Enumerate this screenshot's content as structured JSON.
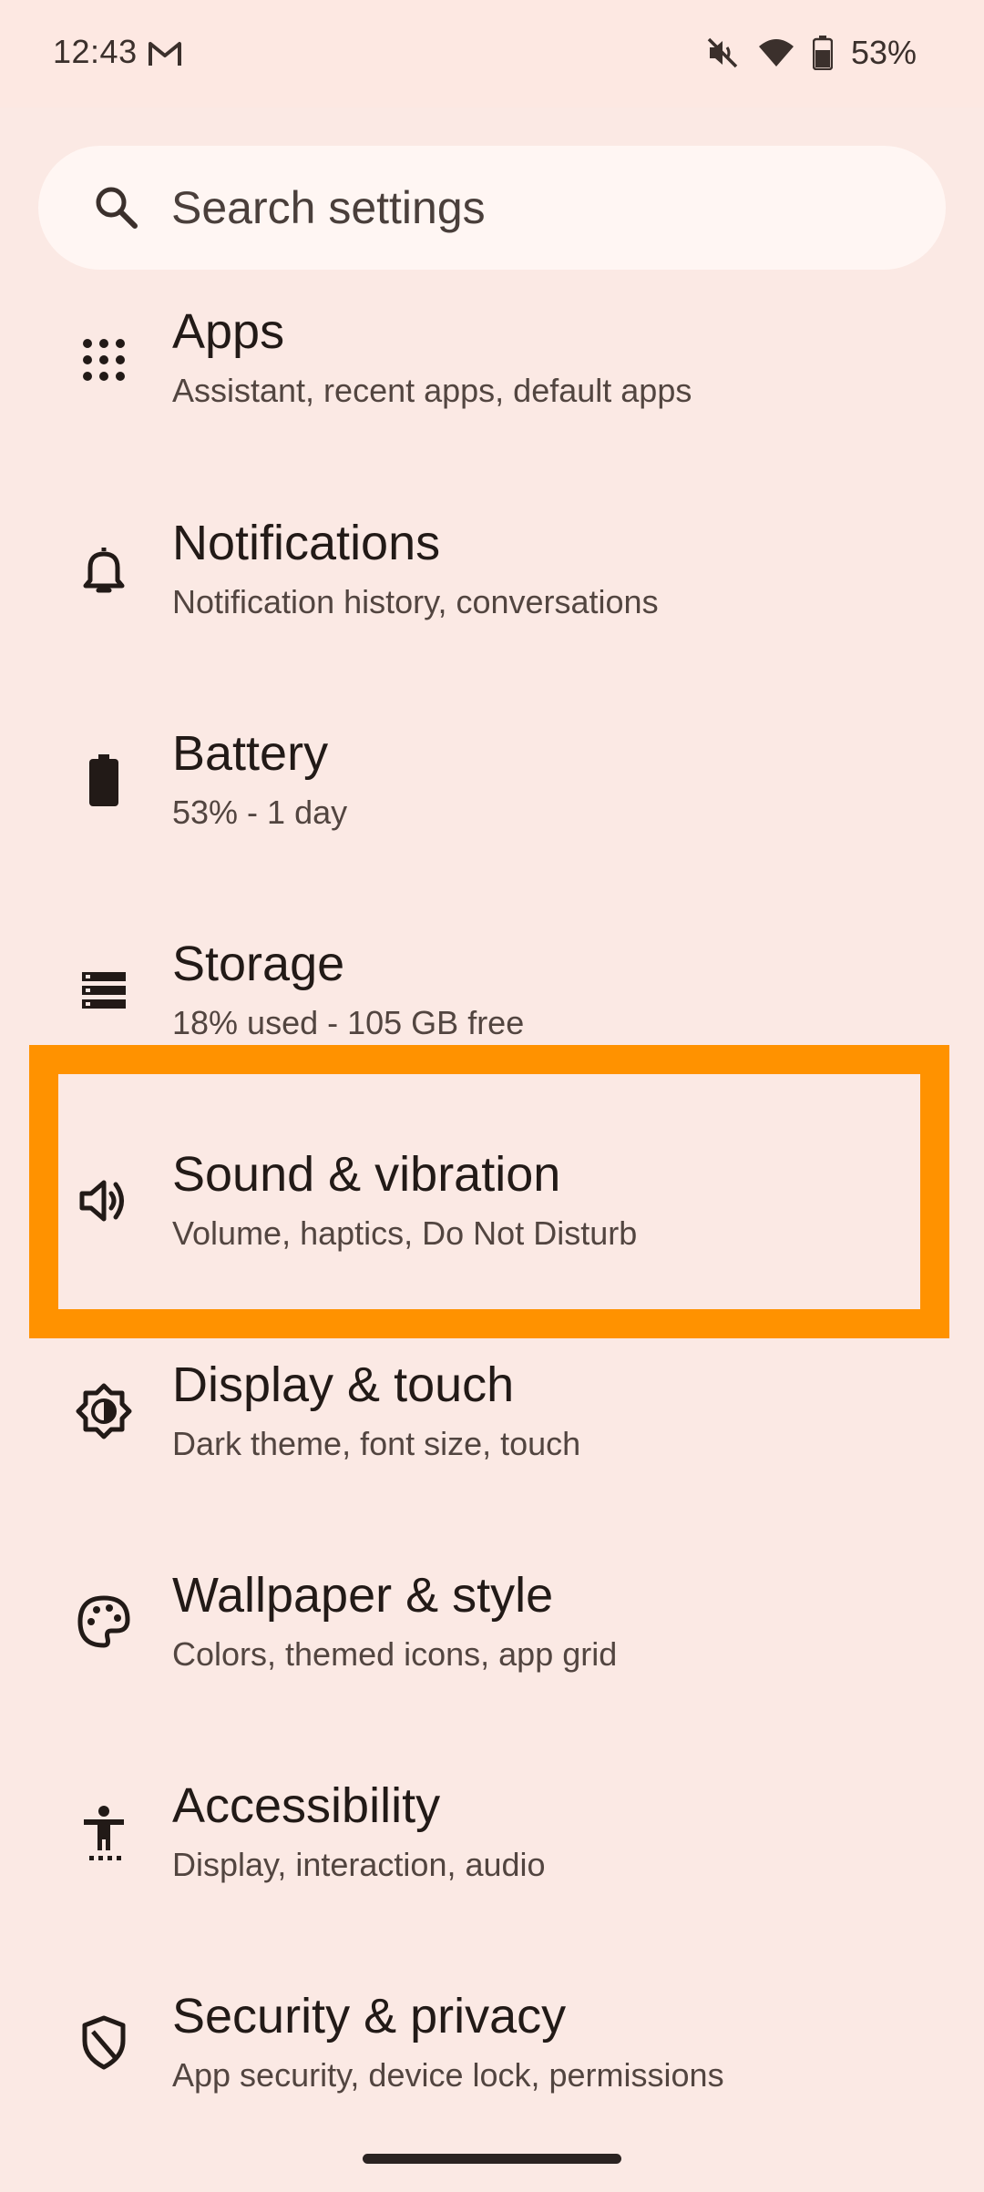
{
  "status_bar": {
    "time": "12:43",
    "battery_percent": "53%",
    "icons": [
      "gmail-icon",
      "mute-vibrate-off-icon",
      "wifi-icon",
      "battery-icon"
    ]
  },
  "search": {
    "placeholder": "Search settings"
  },
  "items": [
    {
      "title": "Apps",
      "subtitle": "Assistant, recent apps, default apps",
      "icon": "apps-grid-icon"
    },
    {
      "title": "Notifications",
      "subtitle": "Notification history, conversations",
      "icon": "bell-icon"
    },
    {
      "title": "Battery",
      "subtitle": "53% - 1 day",
      "icon": "battery-icon"
    },
    {
      "title": "Storage",
      "subtitle": "18% used - 105 GB free",
      "icon": "storage-icon"
    },
    {
      "title": "Sound & vibration",
      "subtitle": "Volume, haptics, Do Not Disturb",
      "icon": "speaker-icon"
    },
    {
      "title": "Display & touch",
      "subtitle": "Dark theme, font size, touch",
      "icon": "brightness-icon"
    },
    {
      "title": "Wallpaper & style",
      "subtitle": "Colors, themed icons, app grid",
      "icon": "palette-icon"
    },
    {
      "title": "Accessibility",
      "subtitle": "Display, interaction, audio",
      "icon": "accessibility-icon"
    },
    {
      "title": "Security & privacy",
      "subtitle": "App security, device lock, permissions",
      "icon": "shield-icon"
    }
  ],
  "highlighted_item": "Sound & vibration",
  "colors": {
    "background": "#fbe9e4",
    "highlight": "#ff9200",
    "text_primary": "#221a17",
    "text_secondary": "#524540"
  }
}
